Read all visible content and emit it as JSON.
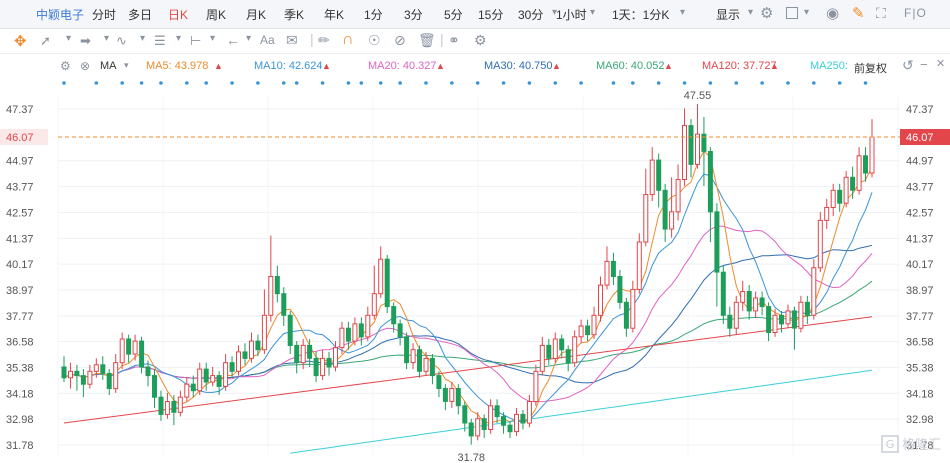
{
  "header": {
    "stock_name": "中颖电子",
    "timeframes": [
      {
        "label": "分时",
        "active": false
      },
      {
        "label": "多日",
        "active": false
      },
      {
        "label": "日K",
        "active": true
      },
      {
        "label": "周K",
        "active": false
      },
      {
        "label": "月K",
        "active": false
      },
      {
        "label": "季K",
        "active": false
      },
      {
        "label": "年K",
        "active": false
      },
      {
        "label": "1分",
        "active": false
      },
      {
        "label": "3分",
        "active": false
      },
      {
        "label": "5分",
        "active": false
      },
      {
        "label": "15分",
        "active": false
      },
      {
        "label": "30分",
        "active": false
      },
      {
        "label": "1小时",
        "active": false
      },
      {
        "label": "1天：1分K",
        "active": false
      }
    ],
    "display_label": "显示",
    "fio_label": "F|O"
  },
  "toolbar2": {
    "icons": [
      "crosshair-icon",
      "line-tool-icon",
      "ray-tool-icon",
      "wave-tool-icon",
      "fib-tool-icon",
      "range-tool-icon",
      "arrow-left-icon",
      "text-tool-icon",
      "comment-icon",
      "pencil-icon",
      "magnet-icon",
      "lock-icon",
      "eye-off-icon",
      "trash-icon",
      "link-icon",
      "settings-icon"
    ],
    "text_label": "Aa"
  },
  "indicators": {
    "name": "MA",
    "fq_label": "前复权",
    "items": [
      {
        "label": "MA5: 43.978",
        "color": "#ef8a2b"
      },
      {
        "label": "MA10: 42.624",
        "color": "#3a94d8"
      },
      {
        "label": "MA20: 40.327",
        "color": "#e062c2"
      },
      {
        "label": "MA30: 40.750",
        "color": "#2f6db3"
      },
      {
        "label": "MA60: 40.052",
        "color": "#3aa876"
      },
      {
        "label": "MA120: 37.727",
        "color": "#e2454a"
      },
      {
        "label": "MA250:",
        "color": "#3ad0d8"
      }
    ]
  },
  "price_current": "46.07",
  "labels": {
    "high": "47.55",
    "low": "31.78"
  },
  "watermark": "格隆汇",
  "chart_data": {
    "type": "candlestick",
    "y_ticks": [
      "47.37",
      "44.97",
      "43.77",
      "42.57",
      "41.37",
      "40.17",
      "38.97",
      "37.77",
      "36.58",
      "35.38",
      "34.18",
      "32.98",
      "31.78"
    ],
    "ylim": [
      31.78,
      47.37
    ],
    "current_price": 46.07,
    "high": 47.55,
    "low": 31.78,
    "colors": {
      "up": "#e2454a",
      "down": "#1d9e5a",
      "ma5": "#ef8a2b",
      "ma10": "#3a94d8",
      "ma20": "#e062c2",
      "ma30": "#2f6db3",
      "ma60": "#3aa876",
      "ma120": "#e2454a",
      "ma250": "#3ad0d8"
    },
    "ohlc": [
      [
        35.4,
        34.9,
        35.9,
        34.7
      ],
      [
        34.9,
        35.2,
        35.6,
        34.4
      ],
      [
        35.2,
        35.0,
        35.5,
        34.3
      ],
      [
        35.0,
        34.6,
        35.3,
        34.0
      ],
      [
        34.6,
        35.2,
        35.5,
        34.4
      ],
      [
        35.2,
        35.5,
        35.8,
        34.9
      ],
      [
        35.5,
        35.1,
        35.9,
        34.8
      ],
      [
        35.1,
        34.4,
        35.3,
        34.1
      ],
      [
        34.4,
        35.6,
        36.0,
        34.2
      ],
      [
        35.6,
        36.7,
        37.0,
        35.3
      ],
      [
        36.7,
        36.0,
        36.9,
        35.6
      ],
      [
        36.0,
        36.6,
        36.9,
        35.7
      ],
      [
        36.6,
        35.4,
        36.8,
        35.1
      ],
      [
        35.4,
        35.0,
        35.7,
        34.5
      ],
      [
        35.0,
        34.0,
        35.3,
        33.5
      ],
      [
        34.0,
        33.2,
        34.3,
        32.9
      ],
      [
        33.2,
        33.8,
        34.2,
        33.0
      ],
      [
        33.8,
        33.3,
        34.1,
        32.7
      ],
      [
        33.3,
        34.0,
        34.3,
        33.1
      ],
      [
        34.0,
        34.6,
        34.9,
        33.8
      ],
      [
        34.6,
        34.3,
        35.0,
        34.0
      ],
      [
        34.3,
        35.3,
        35.6,
        34.1
      ],
      [
        35.3,
        34.7,
        35.6,
        34.3
      ],
      [
        34.7,
        35.0,
        35.4,
        34.5
      ],
      [
        35.0,
        34.5,
        35.2,
        34.1
      ],
      [
        34.5,
        35.6,
        36.0,
        34.3
      ],
      [
        35.6,
        35.2,
        35.9,
        34.9
      ],
      [
        35.2,
        36.1,
        36.4,
        35.0
      ],
      [
        36.1,
        35.8,
        36.5,
        35.5
      ],
      [
        35.8,
        36.6,
        37.0,
        35.6
      ],
      [
        36.6,
        36.2,
        36.9,
        35.9
      ],
      [
        36.2,
        37.8,
        39.0,
        36.0
      ],
      [
        37.8,
        39.6,
        41.5,
        37.5
      ],
      [
        39.6,
        38.8,
        40.1,
        38.4
      ],
      [
        38.8,
        37.8,
        39.1,
        37.3
      ],
      [
        37.8,
        36.4,
        38.0,
        36.0
      ],
      [
        36.4,
        35.6,
        36.6,
        35.1
      ],
      [
        35.6,
        36.4,
        36.7,
        35.3
      ],
      [
        36.4,
        35.8,
        36.7,
        35.4
      ],
      [
        35.8,
        35.0,
        36.1,
        34.7
      ],
      [
        35.0,
        35.8,
        36.2,
        34.8
      ],
      [
        35.8,
        35.4,
        36.1,
        35.0
      ],
      [
        35.4,
        36.3,
        36.6,
        35.2
      ],
      [
        36.3,
        37.2,
        37.5,
        36.0
      ],
      [
        37.2,
        36.6,
        37.5,
        36.2
      ],
      [
        36.6,
        37.4,
        37.7,
        36.4
      ],
      [
        37.4,
        36.8,
        37.7,
        36.4
      ],
      [
        36.8,
        37.8,
        38.2,
        36.6
      ],
      [
        37.8,
        38.8,
        40.1,
        37.6
      ],
      [
        38.8,
        40.4,
        41.0,
        38.6
      ],
      [
        40.4,
        38.2,
        40.6,
        37.9
      ],
      [
        38.2,
        37.4,
        38.4,
        37.0
      ],
      [
        37.4,
        36.8,
        37.6,
        36.4
      ],
      [
        36.8,
        35.6,
        37.0,
        35.3
      ],
      [
        35.6,
        36.2,
        36.5,
        35.3
      ],
      [
        36.2,
        35.2,
        36.4,
        34.9
      ],
      [
        35.2,
        35.8,
        36.1,
        35.0
      ],
      [
        35.8,
        35.0,
        36.0,
        34.6
      ],
      [
        35.0,
        34.4,
        35.2,
        34.0
      ],
      [
        34.4,
        33.8,
        34.6,
        33.4
      ],
      [
        33.8,
        34.4,
        34.7,
        33.5
      ],
      [
        34.4,
        33.6,
        34.6,
        33.2
      ],
      [
        33.6,
        32.8,
        33.8,
        32.4
      ],
      [
        32.8,
        32.2,
        33.0,
        31.8
      ],
      [
        32.2,
        33.0,
        33.3,
        32.0
      ],
      [
        33.0,
        32.5,
        33.2,
        32.1
      ],
      [
        32.5,
        33.6,
        33.9,
        32.3
      ],
      [
        33.6,
        33.1,
        33.9,
        32.8
      ],
      [
        33.1,
        32.7,
        33.3,
        32.3
      ],
      [
        32.7,
        32.4,
        32.9,
        32.1
      ],
      [
        32.4,
        33.2,
        33.5,
        32.2
      ],
      [
        33.2,
        32.8,
        33.4,
        32.5
      ],
      [
        32.8,
        33.8,
        34.1,
        32.6
      ],
      [
        33.8,
        35.2,
        35.5,
        33.6
      ],
      [
        35.2,
        36.4,
        36.8,
        35.0
      ],
      [
        36.4,
        35.8,
        36.7,
        35.5
      ],
      [
        35.8,
        36.7,
        37.0,
        35.6
      ],
      [
        36.7,
        36.2,
        36.9,
        35.8
      ],
      [
        36.2,
        35.6,
        36.4,
        35.2
      ],
      [
        35.6,
        36.8,
        37.1,
        35.4
      ],
      [
        36.8,
        37.3,
        37.6,
        36.5
      ],
      [
        37.3,
        36.9,
        37.6,
        36.6
      ],
      [
        36.9,
        37.8,
        38.2,
        36.7
      ],
      [
        37.8,
        39.2,
        39.6,
        37.5
      ],
      [
        39.2,
        40.3,
        41.0,
        39.0
      ],
      [
        40.3,
        39.6,
        40.7,
        39.2
      ],
      [
        39.6,
        38.4,
        39.9,
        38.1
      ],
      [
        38.4,
        37.2,
        38.6,
        36.8
      ],
      [
        37.2,
        39.0,
        39.4,
        37.0
      ],
      [
        39.0,
        41.2,
        41.6,
        38.8
      ],
      [
        41.2,
        43.4,
        44.6,
        41.0
      ],
      [
        43.4,
        45.0,
        45.6,
        43.1
      ],
      [
        45.0,
        43.6,
        45.3,
        42.8
      ],
      [
        43.6,
        41.8,
        43.9,
        41.2
      ],
      [
        41.8,
        42.6,
        44.2,
        41.4
      ],
      [
        42.6,
        44.1,
        44.8,
        42.2
      ],
      [
        44.1,
        46.6,
        47.4,
        43.8
      ],
      [
        46.6,
        44.8,
        46.9,
        44.2
      ],
      [
        44.8,
        46.2,
        47.6,
        44.6
      ],
      [
        46.2,
        45.4,
        47.0,
        43.8
      ],
      [
        45.4,
        42.6,
        45.6,
        41.2
      ],
      [
        42.6,
        39.8,
        43.0,
        38.2
      ],
      [
        39.8,
        37.8,
        40.1,
        37.4
      ],
      [
        37.8,
        37.2,
        38.2,
        36.8
      ],
      [
        37.2,
        38.4,
        38.7,
        36.9
      ],
      [
        38.4,
        38.9,
        39.4,
        38.0
      ],
      [
        38.9,
        38.0,
        39.2,
        37.6
      ],
      [
        38.0,
        38.6,
        38.9,
        37.7
      ],
      [
        38.6,
        38.2,
        38.9,
        37.8
      ],
      [
        38.2,
        37.0,
        38.4,
        36.6
      ],
      [
        37.0,
        37.8,
        38.1,
        36.8
      ],
      [
        37.8,
        37.4,
        38.0,
        37.0
      ],
      [
        37.4,
        38.0,
        38.3,
        37.2
      ],
      [
        38.0,
        37.2,
        38.2,
        36.2
      ],
      [
        37.2,
        38.4,
        38.7,
        37.0
      ],
      [
        38.4,
        37.8,
        38.7,
        37.4
      ],
      [
        37.8,
        40.0,
        40.4,
        37.6
      ],
      [
        40.0,
        42.2,
        42.6,
        39.8
      ],
      [
        42.2,
        42.8,
        43.2,
        41.8
      ],
      [
        42.8,
        43.6,
        43.9,
        42.4
      ],
      [
        43.6,
        43.0,
        43.9,
        42.6
      ],
      [
        43.0,
        44.2,
        44.5,
        42.8
      ],
      [
        44.2,
        43.6,
        44.7,
        43.2
      ],
      [
        43.6,
        45.2,
        45.6,
        43.4
      ],
      [
        45.2,
        44.4,
        45.6,
        44.0
      ],
      [
        44.4,
        46.07,
        46.9,
        44.2
      ]
    ]
  }
}
